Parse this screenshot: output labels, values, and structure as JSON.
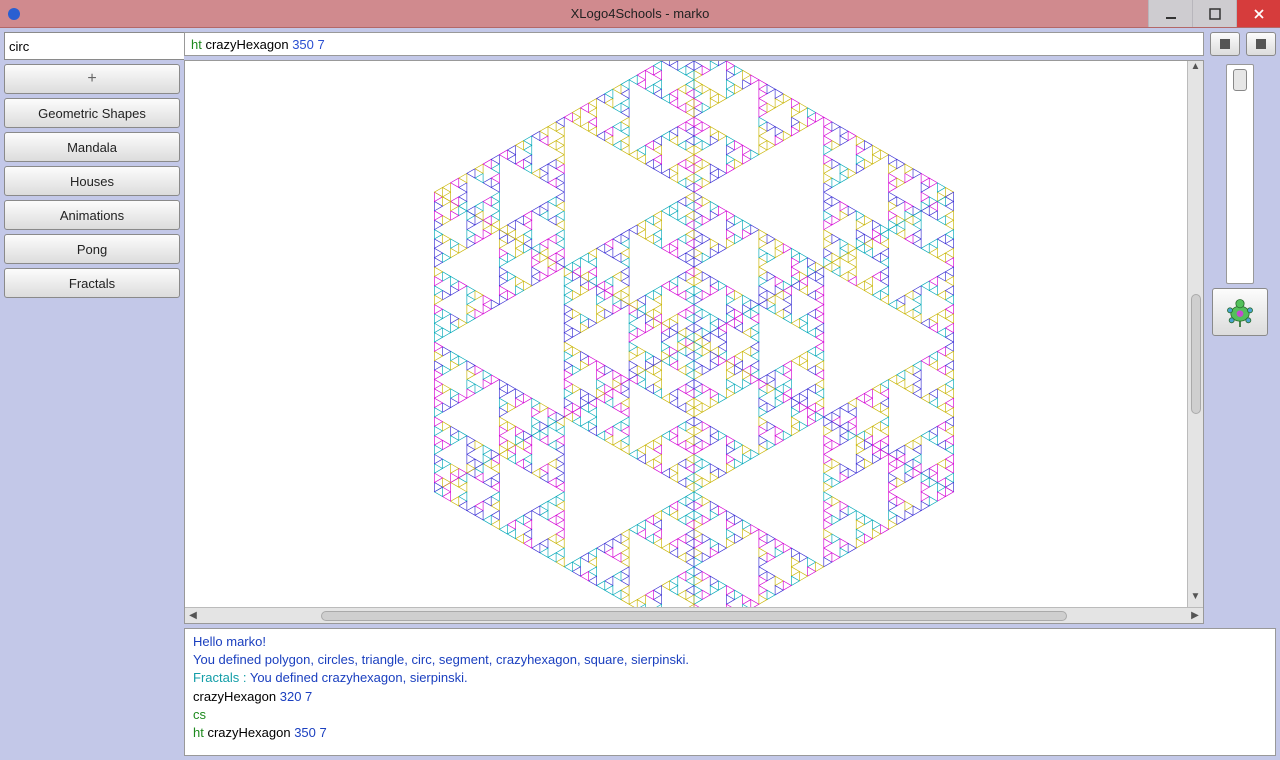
{
  "window": {
    "title": "XLogo4Schools - marko"
  },
  "search": {
    "value": "circ"
  },
  "categories": [
    {
      "label": "Geometric Shapes"
    },
    {
      "label": "Mandala"
    },
    {
      "label": "Houses"
    },
    {
      "label": "Animations"
    },
    {
      "label": "Pong"
    },
    {
      "label": "Fractals"
    }
  ],
  "command": {
    "prefix": "ht",
    "proc": "crazyHexagon",
    "args": "350 7"
  },
  "console": {
    "greet": "Hello marko!",
    "defined_all": "You defined polygon, circles, triangle, circ, segment, crazyhexagon, square, sierpinski.",
    "defined_file_prefix": "Fractals : ",
    "defined_file": "You defined crazyhexagon, sierpinski.",
    "hist1_proc": "crazyHexagon",
    "hist1_args": "320 7",
    "hist2": "cs",
    "hist3_prefix": "ht",
    "hist3_proc": "crazyHexagon",
    "hist3_args": "350 7"
  }
}
